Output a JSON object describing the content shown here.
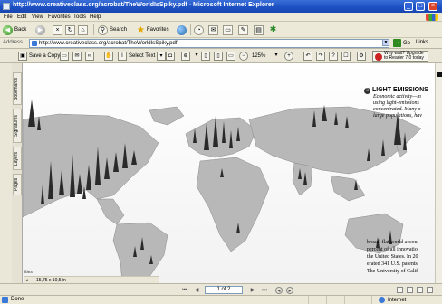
{
  "window": {
    "title": "http://www.creativeclass.org/acrobat/TheWorldIsSpiky.pdf - Microsoft Internet Explorer",
    "controls": [
      "_",
      "□",
      "×"
    ]
  },
  "menu": [
    "File",
    "Edit",
    "View",
    "Favorites",
    "Tools",
    "Help"
  ],
  "toolbar": {
    "back_label": "Back",
    "search_label": "Search",
    "favorites_label": "Favorites"
  },
  "address": {
    "label": "Address",
    "url": "http://www.creativeclass.org/acrobat/TheWorldIsSpiky.pdf",
    "go_label": "Go",
    "links_label": "Links"
  },
  "acrobat": {
    "save_copy_label": "Save a Copy",
    "select_text_label": "Select Text",
    "zoom_value": "125%",
    "upgrade_line1": "Why wait? Upgrade",
    "upgrade_line2": "to Reader 7.0 today"
  },
  "sidetabs": [
    "Bookmarks",
    "Signatures",
    "Layers",
    "Pages"
  ],
  "article": {
    "number": "3",
    "heading": "LIGHT EMISSIONS",
    "lines": [
      "Economic activity—m",
      "using light-emissions",
      "concentrated. Many o",
      "large populations, hav"
    ],
    "body_lines": [
      "broad, flat world accou",
      "percent of all innovatio",
      "the United States. In 20",
      "erated 341 U.S. patents",
      "The University of Calif"
    ],
    "credit": "ities"
  },
  "document": {
    "page_size": "15,75 x 10,5 in"
  },
  "pager": {
    "page_indicator": "1 of 2"
  },
  "status": {
    "done": "Done",
    "zone": "Internet"
  },
  "colors": {
    "titlebar": "#1b4fc2",
    "chrome": "#ece9d8",
    "land": "#b5b5b5",
    "spikes": "#2a2a2a"
  }
}
